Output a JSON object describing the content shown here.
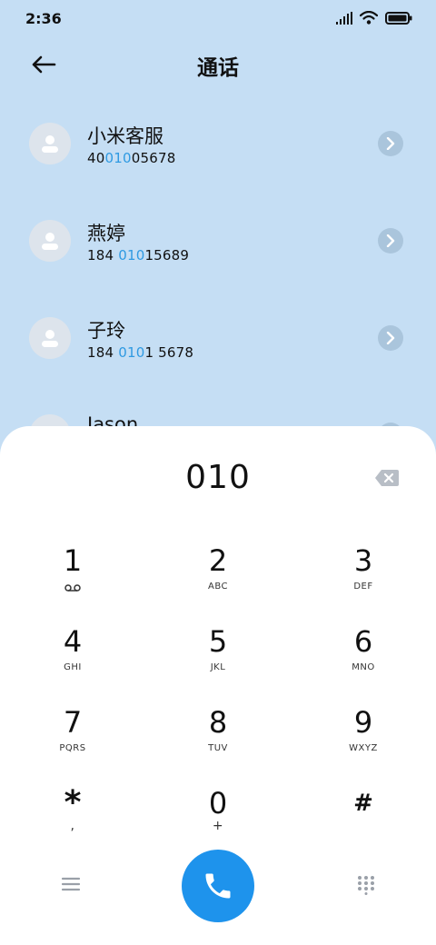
{
  "status": {
    "time": "2:36"
  },
  "header": {
    "title": "通话"
  },
  "contacts": [
    {
      "name": "小米客服",
      "num_pre": "40",
      "num_hl": "010",
      "num_post": "05678"
    },
    {
      "name": "燕婷",
      "num_pre": "184 ",
      "num_hl": "010",
      "num_post": "15689"
    },
    {
      "name": "子玲",
      "num_pre": "184 ",
      "num_hl": "010",
      "num_post": "1 5678"
    },
    {
      "name": "Jason",
      "num_pre": "",
      "num_hl": "",
      "num_post": ""
    }
  ],
  "dialer": {
    "number": "010",
    "keys": [
      {
        "digit": "1",
        "letters": ""
      },
      {
        "digit": "2",
        "letters": "ABC"
      },
      {
        "digit": "3",
        "letters": "DEF"
      },
      {
        "digit": "4",
        "letters": "GHI"
      },
      {
        "digit": "5",
        "letters": "JKL"
      },
      {
        "digit": "6",
        "letters": "MNO"
      },
      {
        "digit": "7",
        "letters": "PQRS"
      },
      {
        "digit": "8",
        "letters": "TUV"
      },
      {
        "digit": "9",
        "letters": "WXYZ"
      },
      {
        "digit": "*",
        "letters": ","
      },
      {
        "digit": "0",
        "letters": "+"
      },
      {
        "digit": "#",
        "letters": ""
      }
    ]
  },
  "icons": {
    "back": "arrow-left-icon",
    "backspace": "backspace-icon",
    "voicemail": "voicemail-icon",
    "menu": "menu-icon",
    "call": "phone-icon",
    "keypad": "keypad-icon",
    "chevron": "chevron-right-icon",
    "avatar": "person-icon"
  },
  "colors": {
    "background": "#c5def4",
    "highlight": "#2f9ae2",
    "call": "#1e93ec"
  }
}
